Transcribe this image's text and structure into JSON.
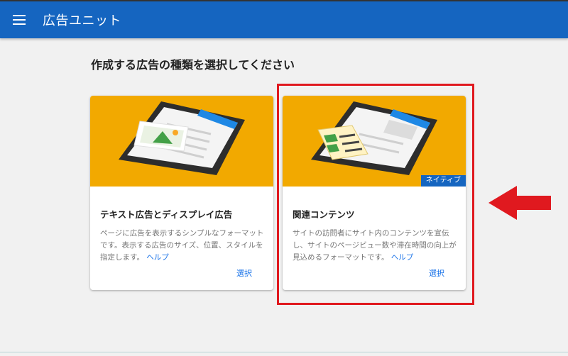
{
  "app_bar": {
    "title": "広告ユニット"
  },
  "page": {
    "heading": "作成する広告の種類を選択してください"
  },
  "cards": [
    {
      "title": "テキスト広告とディスプレイ広告",
      "description": "ページに広告を表示するシンプルなフォーマットです。表示する広告のサイズ、位置、スタイルを指定します。",
      "help": "ヘルプ",
      "action": "選択"
    },
    {
      "badge": "ネイティブ",
      "title": "関連コンテンツ",
      "description": "サイトの訪問者にサイト内のコンテンツを宣伝し、サイトのページビュー数や滞在時間の向上が見込めるフォーマットです。",
      "help": "ヘルプ",
      "action": "選択"
    }
  ],
  "colors": {
    "app_bar": "#1565c0",
    "card_media": "#f2a900",
    "annotation_red": "#e0191f",
    "link": "#1a73e8"
  },
  "icons": {
    "menu": "hamburger-menu-icon"
  }
}
